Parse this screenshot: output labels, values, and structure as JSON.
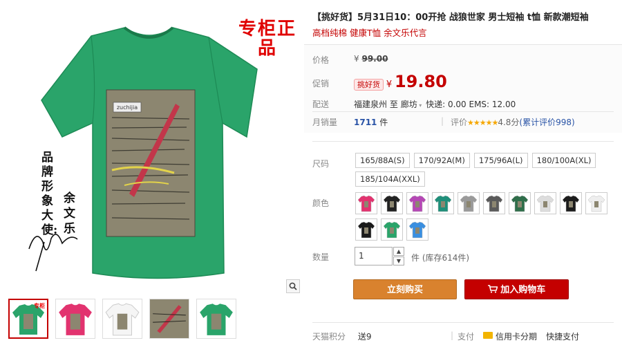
{
  "gallery": {
    "promo_stamp": "专柜正品",
    "brand_vertical": "品牌形象大使:",
    "name_vertical": "余文乐",
    "shirt_tag": "zuchijia",
    "thumbnails": [
      {
        "name": "thumb-green",
        "color": "#2aa46a",
        "badge": "专柜"
      },
      {
        "name": "thumb-pink",
        "color": "#e2336f"
      },
      {
        "name": "thumb-white",
        "color": "#f2f2f2"
      },
      {
        "name": "thumb-print-detail",
        "color": "#8c8670"
      },
      {
        "name": "thumb-green-2",
        "color": "#2aa46a"
      }
    ]
  },
  "product": {
    "title": "【挑好货】5月31日10：00开抢 战狼世家 男士短袖 t恤 新款潮短袖",
    "subtitle": "高档纯棉 健康T恤 余文乐代言"
  },
  "price": {
    "label": "价格",
    "currency": "¥",
    "original": "99.00",
    "promo_label": "促销",
    "promo_tag": "挑好货",
    "promo_price": "19.80"
  },
  "delivery": {
    "label": "配送",
    "from": "福建泉州",
    "to_word": "至",
    "to": "廊坊",
    "detail": "快递: 0.00 EMS: 12.00"
  },
  "sales": {
    "label": "月销量",
    "count": "1711",
    "unit": "件",
    "rating_label": "评价",
    "stars": "★★★★★",
    "score": "4.8分",
    "reviews": "(累计评价998)"
  },
  "size": {
    "label": "尺码",
    "options": [
      "165/88A(S)",
      "170/92A(M)",
      "175/96A(L)",
      "180/100A(XL)",
      "185/104A(XXL)"
    ]
  },
  "color": {
    "label": "颜色",
    "swatches": [
      "#e2336f",
      "#222222",
      "#b548b5",
      "#1f8f7a",
      "#9a9a9a",
      "#5a5a5a",
      "#2f6e4a",
      "#dddddd",
      "#1c1c1c",
      "#eeeeee",
      "#1a1a1a",
      "#2aa46a",
      "#3a8fe0"
    ]
  },
  "quantity": {
    "label": "数量",
    "value": "1",
    "unit": "件",
    "stock": "(库存614件)"
  },
  "actions": {
    "buy_now": "立刻购买",
    "add_cart": "加入购物车"
  },
  "footer": {
    "label": "天猫积分",
    "points": "送9",
    "pay_label": "支付",
    "credit": "信用卡分期",
    "quick": "快捷支付"
  },
  "colors": {
    "accent_red": "#c40000",
    "buy_orange": "#d9822e",
    "shirt_green": "#2aa46a"
  }
}
